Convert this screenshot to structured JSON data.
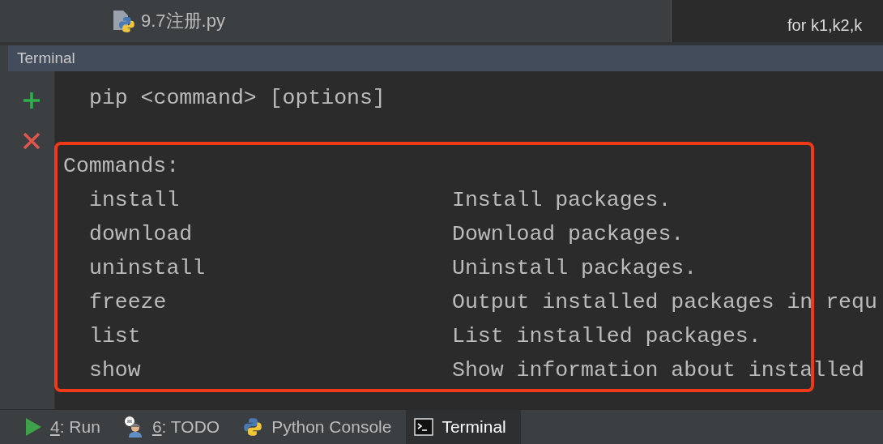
{
  "project_tree": {
    "file": "9.7注册.py"
  },
  "editor": {
    "code_line": "for k1,k2,k"
  },
  "terminal": {
    "title": "Terminal",
    "usage": "pip <command> [options]",
    "heading": "Commands:",
    "commands": [
      {
        "name": "install",
        "description": "Install packages."
      },
      {
        "name": "download",
        "description": "Download packages."
      },
      {
        "name": "uninstall",
        "description": "Uninstall packages."
      },
      {
        "name": "freeze",
        "description": "Output installed packages in requ"
      },
      {
        "name": "list",
        "description": "List installed packages."
      },
      {
        "name": "show",
        "description": "Show information about installed"
      }
    ]
  },
  "tool_tabs": [
    {
      "kind": "run",
      "key": "4",
      "label": ": Run",
      "selected": false
    },
    {
      "kind": "todo",
      "key": "6",
      "label": ": TODO",
      "selected": false
    },
    {
      "kind": "python",
      "label": "Python Console",
      "selected": false
    },
    {
      "kind": "terminal",
      "label": "Terminal",
      "selected": true
    }
  ]
}
